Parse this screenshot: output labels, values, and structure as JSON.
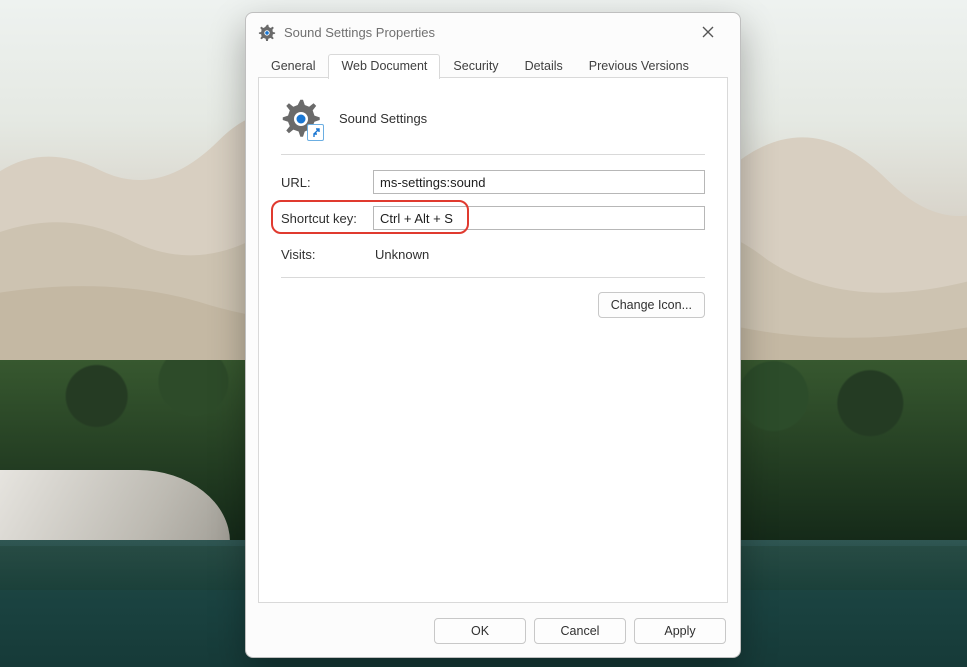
{
  "window": {
    "title": "Sound Settings Properties"
  },
  "tabs": {
    "general": "General",
    "web_document": "Web Document",
    "security": "Security",
    "details": "Details",
    "previous_versions": "Previous Versions"
  },
  "header": {
    "name": "Sound Settings"
  },
  "fields": {
    "url_label": "URL:",
    "url_value": "ms-settings:sound",
    "shortcut_label": "Shortcut key:",
    "shortcut_value": "Ctrl + Alt + S",
    "visits_label": "Visits:",
    "visits_value": "Unknown"
  },
  "buttons": {
    "change_icon": "Change Icon...",
    "ok": "OK",
    "cancel": "Cancel",
    "apply": "Apply"
  }
}
